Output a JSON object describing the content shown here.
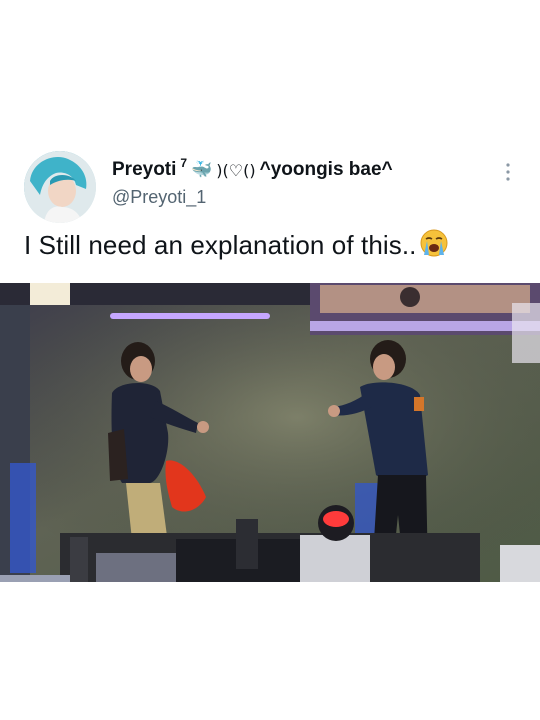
{
  "tweet": {
    "user": {
      "display_name": "Preyoti",
      "superscript": "7",
      "whale_icon": "whale-emoji",
      "symbols": ")(♡()",
      "suffix": "^yoongis bae^",
      "handle": "@Preyoti_1",
      "avatar": "profile-photo-blue-hair"
    },
    "text": "I Still need an explanation of this..",
    "emoji": "loudly-crying-face",
    "more_icon": "more-options-icon"
  },
  "media": {
    "description_icon": "concert-stage-photo"
  }
}
